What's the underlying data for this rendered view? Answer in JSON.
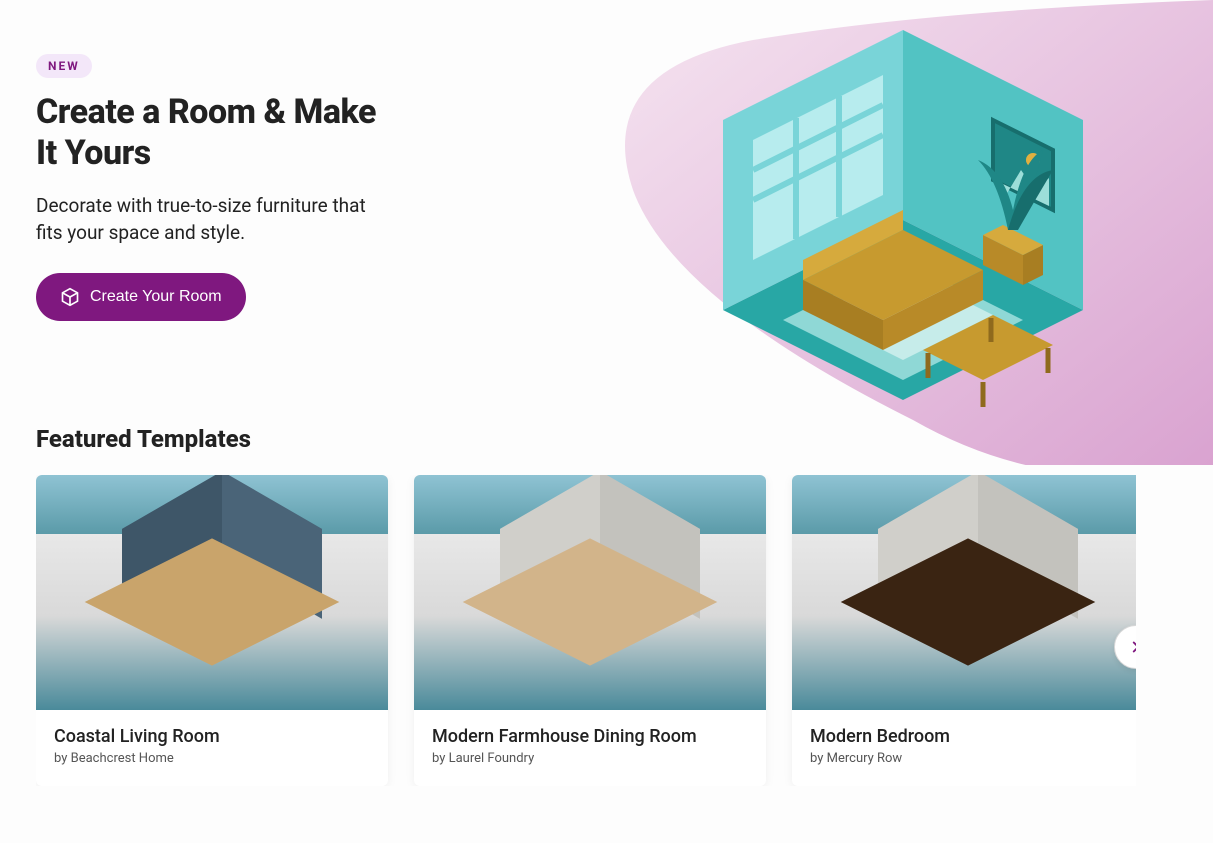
{
  "hero": {
    "badge": "NEW",
    "title": "Create a Room & Make It Yours",
    "subtitle": "Decorate with true-to-size furniture that fits your space and style.",
    "cta_label": "Create Your Room"
  },
  "section_title": "Featured Templates",
  "templates": [
    {
      "title": "Coastal Living Room",
      "byline": "by Beachcrest Home",
      "wall": "#3e5668",
      "floor": "#c9a46b"
    },
    {
      "title": "Modern Farmhouse Dining Room",
      "byline": "by Laurel Foundry",
      "wall": "#d0cfca",
      "floor": "#d2b48a"
    },
    {
      "title": "Modern Bedroom",
      "byline": "by Mercury Row",
      "wall": "#d0cfca",
      "floor": "#3a2412"
    }
  ],
  "colors": {
    "accent": "#7f187f",
    "badge_bg": "#f3e7f9",
    "teal_light": "#79d4d8",
    "teal_dark": "#28a7a5",
    "gold": "#c79a2f",
    "pink_blob_a": "#f2dcec",
    "pink_blob_b": "#e0a8d5"
  }
}
